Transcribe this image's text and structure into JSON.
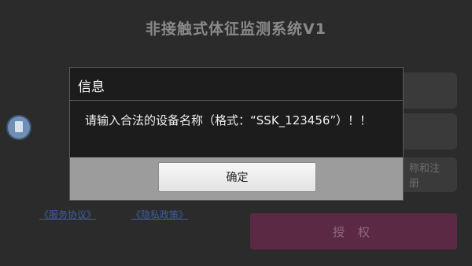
{
  "app": {
    "title": "非接触式体征监测系统V1",
    "field_1_text": "",
    "field_2_text": "",
    "register_label": "称和注册",
    "service_link": "《服务协议》",
    "privacy_link": "《隐私政策》",
    "auth_button": "授 权"
  },
  "dialog": {
    "title": "信息",
    "message": "请输入合法的设备名称（格式：“SSK_123456”）！！",
    "ok_label": "确定"
  },
  "colors": {
    "auth_button_bg": "#5c2944",
    "link_color": "#3f5fa0",
    "dialog_bg": "#1c1c1c",
    "dialog_footer": "#9c9c9c"
  }
}
